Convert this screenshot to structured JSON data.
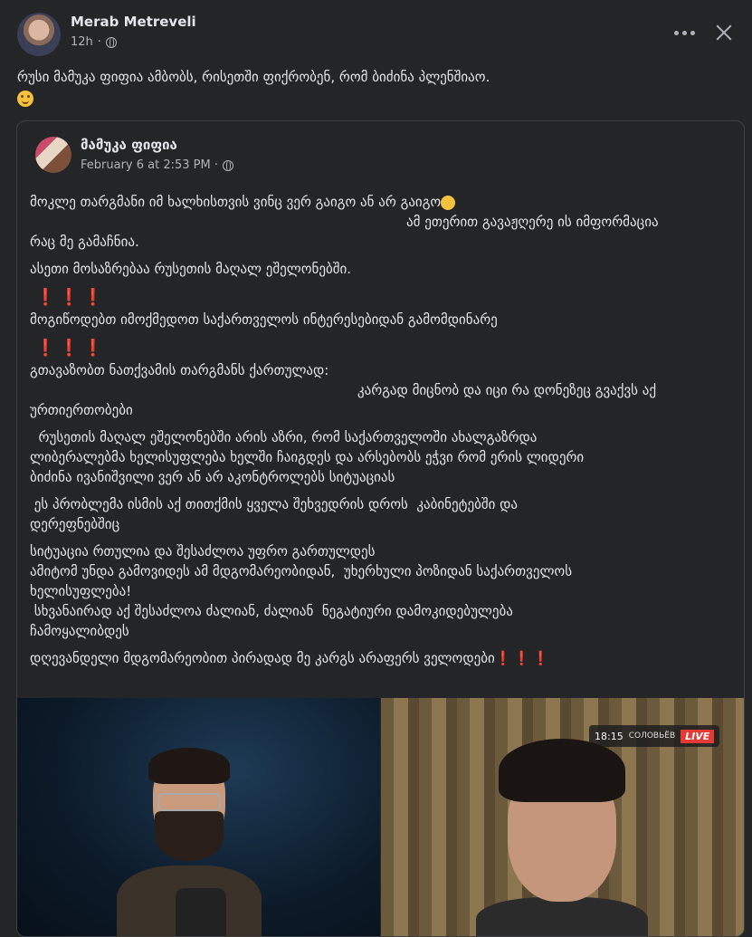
{
  "post": {
    "author": "Merab Metreveli",
    "time": "12h",
    "text": "რუსი მამუკა ფიფია ამბობს, რისეთში ფიქრობენ, რომ ბიძინა პლენშიაო."
  },
  "shared_post": {
    "author": "მამუკა ფიფია",
    "date": "February 6 at 2:53 PM · ",
    "lines": {
      "l1": "მოკლე თარგმანი იმ ხალხისთვის ვინც ვერ გაიგო ან არ გაიგო",
      "l2": "ამ ეთერით გავაჟღერე ის იმფორმაცია",
      "l3": "რაც მე გამაჩნია.",
      "l4": "ასეთი მოსაზრებაა რუსეთის მაღალ ეშელონებში.",
      "l5": "მოგიწოდებთ იმოქმედოთ საქართველოს ინტერესებიდან გამომდინარე",
      "l6": "გთავაზობთ ნათქვამის თარგმანს ქართულად:",
      "l7": "კარგად მიცნობ და იცი რა დონეზეც გვაქვს აქ",
      "l8": "ურთიერთობები",
      "l9": "  რუსეთის მაღალ ეშელონებში არის აზრი, რომ საქართველოში ახალგაზრდა",
      "l10": "ლიბერალებმა ხელისუფლება ხელში ჩაიგდეს და არსებობს ეჭვი რომ ერის ლიდერი",
      "l11": "ბიძინა ივანიშვილი ვერ ან არ აკონტროლებს სიტუაციას",
      "l12": " ეს პრობლემა ისმის აქ თითქმის ყველა შეხვედრის დროს  კაბინეტებში და",
      "l13": "დერეფნებშიც",
      "l14": "სიტუაცია რთულია და შესაძლოა უფრო გართულდეს",
      "l15": "ამიტომ უნდა გამოვიდეს ამ მდგომარეობიდან,  უხერხული პოზიდან საქართველოს",
      "l16": "ხელისუფლება!",
      "l17": " სხვანაირად აქ შესაძლოა ძალიან, ძალიან  ნეგატიური დამოკიდებულება",
      "l18": "ჩამოყალიბდეს",
      "l19": "დღევანდელი მდგომარეობით პირადად მე კარგს არაფერს ველოდები",
      "bangs": "❗❗❗"
    },
    "video": {
      "time": "18:15",
      "channel": "СОЛОВЬЁВ",
      "live": "LIVE"
    }
  },
  "colors": {
    "background": "#242526",
    "text": "#e4e6eb",
    "muted": "#b0b3b8",
    "alert": "#e53935"
  },
  "icons": [
    "globe-icon",
    "more-icon",
    "close-icon",
    "smile-emoji",
    "wink-emoji",
    "exclamation-icon"
  ]
}
